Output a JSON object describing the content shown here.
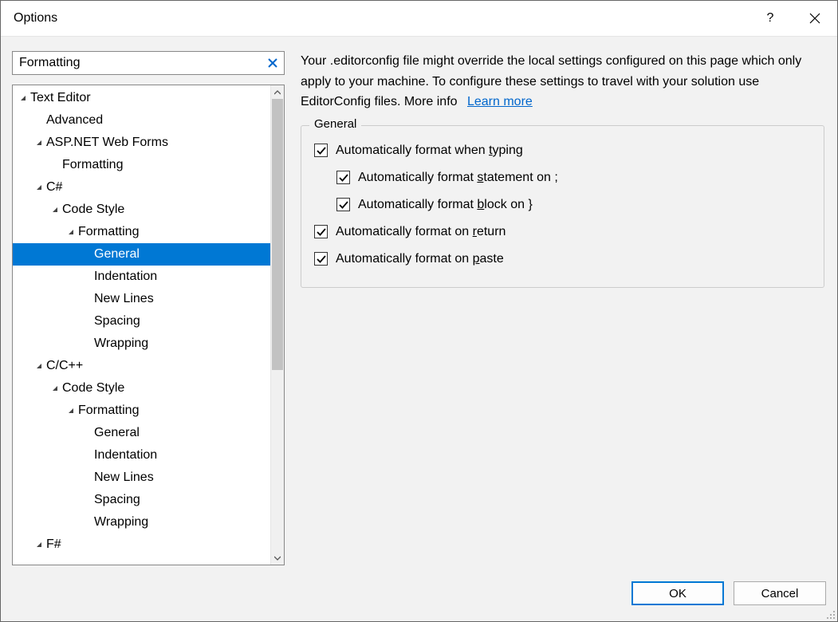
{
  "window": {
    "title": "Options"
  },
  "search": {
    "value": "Formatting"
  },
  "tree": [
    {
      "label": "Text Editor",
      "indent": 0,
      "expanded": true,
      "selected": false
    },
    {
      "label": "Advanced",
      "indent": 1,
      "expanded": null,
      "selected": false
    },
    {
      "label": "ASP.NET Web Forms",
      "indent": 1,
      "expanded": true,
      "selected": false
    },
    {
      "label": "Formatting",
      "indent": 2,
      "expanded": null,
      "selected": false
    },
    {
      "label": "C#",
      "indent": 1,
      "expanded": true,
      "selected": false
    },
    {
      "label": "Code Style",
      "indent": 2,
      "expanded": true,
      "selected": false
    },
    {
      "label": "Formatting",
      "indent": 3,
      "expanded": true,
      "selected": false
    },
    {
      "label": "General",
      "indent": 4,
      "expanded": null,
      "selected": true
    },
    {
      "label": "Indentation",
      "indent": 4,
      "expanded": null,
      "selected": false
    },
    {
      "label": "New Lines",
      "indent": 4,
      "expanded": null,
      "selected": false
    },
    {
      "label": "Spacing",
      "indent": 4,
      "expanded": null,
      "selected": false
    },
    {
      "label": "Wrapping",
      "indent": 4,
      "expanded": null,
      "selected": false
    },
    {
      "label": "C/C++",
      "indent": 1,
      "expanded": true,
      "selected": false
    },
    {
      "label": "Code Style",
      "indent": 2,
      "expanded": true,
      "selected": false
    },
    {
      "label": "Formatting",
      "indent": 3,
      "expanded": true,
      "selected": false
    },
    {
      "label": "General",
      "indent": 4,
      "expanded": null,
      "selected": false
    },
    {
      "label": "Indentation",
      "indent": 4,
      "expanded": null,
      "selected": false
    },
    {
      "label": "New Lines",
      "indent": 4,
      "expanded": null,
      "selected": false
    },
    {
      "label": "Spacing",
      "indent": 4,
      "expanded": null,
      "selected": false
    },
    {
      "label": "Wrapping",
      "indent": 4,
      "expanded": null,
      "selected": false
    },
    {
      "label": "F#",
      "indent": 1,
      "expanded": true,
      "selected": false
    }
  ],
  "description": {
    "text": "Your .editorconfig file might override the local settings configured on this page which only apply to your machine. To configure these settings to travel with your solution use EditorConfig files. More info",
    "link_label": "Learn more"
  },
  "group": {
    "title": "General",
    "checks": [
      {
        "sub": false,
        "checked": true,
        "pre": "Automatically format when ",
        "acc": "t",
        "post": "yping"
      },
      {
        "sub": true,
        "checked": true,
        "pre": "Automatically format ",
        "acc": "s",
        "post": "tatement on ;"
      },
      {
        "sub": true,
        "checked": true,
        "pre": "Automatically format ",
        "acc": "b",
        "post": "lock on }"
      },
      {
        "sub": false,
        "checked": true,
        "pre": "Automatically format on ",
        "acc": "r",
        "post": "eturn"
      },
      {
        "sub": false,
        "checked": true,
        "pre": "Automatically format on ",
        "acc": "p",
        "post": "aste"
      }
    ]
  },
  "buttons": {
    "ok": "OK",
    "cancel": "Cancel"
  }
}
